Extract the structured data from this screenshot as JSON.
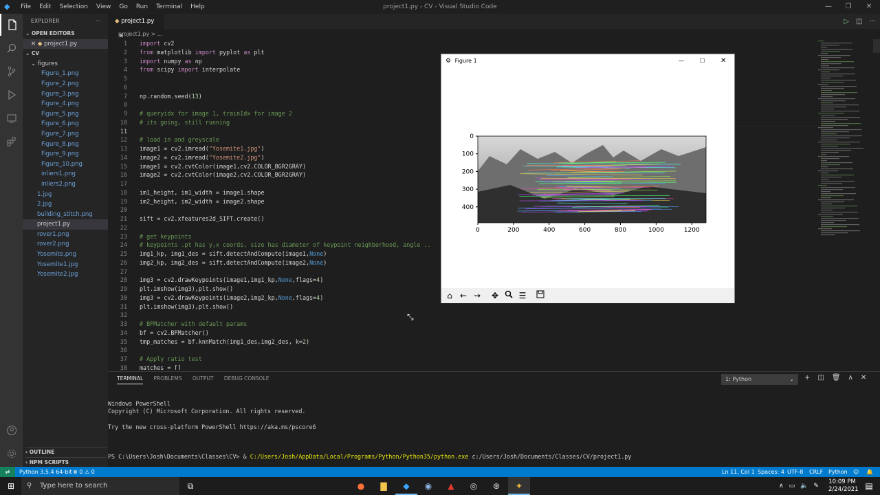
{
  "window": {
    "title": "project1.py - CV - Visual Studio Code",
    "menu": [
      "File",
      "Edit",
      "Selection",
      "View",
      "Go",
      "Run",
      "Terminal",
      "Help"
    ]
  },
  "sidebar": {
    "header": "EXPLORER",
    "open_editors_label": "OPEN EDITORS",
    "open_file": "project1.py",
    "root": "CV",
    "folder": "figures",
    "figure_files": [
      "Figure_1.png",
      "Figure_2.png",
      "Figure_3.png",
      "Figure_4.png",
      "Figure_5.png",
      "Figure_6.png",
      "Figure_7.png",
      "Figure_8.png",
      "Figure_9.png",
      "Figure_10.png",
      "inliers1.png",
      "inliers2.png"
    ],
    "root_files": [
      "1.jpg",
      "2.jpg",
      "building_stitch.png",
      "project1.py",
      "rover1.png",
      "rover2.png",
      "Yosemite.png",
      "Yosemite1.jpg",
      "Yosemite2.jpg"
    ],
    "outline_label": "OUTLINE",
    "npm_label": "NPM SCRIPTS"
  },
  "tabs": {
    "active": "project1.py"
  },
  "breadcrumb": "project1.py > ...",
  "code_lines": [
    "import cv2",
    "from matplotlib import pyplot as plt",
    "import numpy as np",
    "from scipy import interpolate",
    "",
    "",
    "np.random.seed(13)",
    "",
    "# queryidx for image 1, trainIdx for image 2",
    "# its going, still running",
    "",
    "# load in and greyscale",
    "image1 = cv2.imread(\"Yosemite1.jpg\")",
    "image2 = cv2.imread(\"Yosemite2.jpg\")",
    "image1 = cv2.cvtColor(image1,cv2.COLOR_BGR2GRAY)",
    "image2 = cv2.cvtColor(image2,cv2.COLOR_BGR2GRAY)",
    "",
    "im1_height, im1_width = image1.shape",
    "im2_height, im2_width = image2.shape",
    "",
    "sift = cv2.xfeatures2d_SIFT.create()",
    "",
    "# get keypoints",
    "# keypoints .pt has y,x coords, size has diameter of keypoint neighborhood, angle ..",
    "img1_kp, img1_des = sift.detectAndCompute(image1,None)",
    "img2_kp, img2_des = sift.detectAndCompute(image2,None)",
    "",
    "img3 = cv2.drawKeypoints(image1,img1_kp,None,flags=4)",
    "plt.imshow(img3),plt.show()",
    "img3 = cv2.drawKeypoints(image2,img2_kp,None,flags=4)",
    "plt.imshow(img3),plt.show()",
    "",
    "# BFMatcher with default params",
    "bf = cv2.BFMatcher()",
    "tmp_matches = bf.knnMatch(img1_des,img2_des, k=2)",
    "",
    "# Apply ratio test",
    "matches = []"
  ],
  "figure": {
    "title": "Figure 1",
    "x_ticks": [
      "0",
      "200",
      "400",
      "600",
      "800",
      "1000",
      "1200"
    ],
    "y_ticks": [
      "0",
      "100",
      "200",
      "300",
      "400"
    ]
  },
  "panel": {
    "tabs": [
      "TERMINAL",
      "PROBLEMS",
      "OUTPUT",
      "DEBUG CONSOLE"
    ],
    "terminal_selector": "1: Python",
    "lines": [
      "Windows PowerShell",
      "Copyright (C) Microsoft Corporation. All rights reserved.",
      "",
      "Try the new cross-platform PowerShell https://aka.ms/pscore6",
      ""
    ],
    "prompt": "PS C:\\Users\\Josh\\Documents\\Classes\\CV> & ",
    "exe": "C:/Users/Josh/AppData/Local/Programs/Python/Python35/python.exe",
    "script": " c:/Users/Josh/Documents/Classes/CV/project1.py"
  },
  "statusbar": {
    "python": "Python 3.5.4 64-bit",
    "problems": "⊗ 0 ⚠ 0",
    "position": "Ln 11, Col 1",
    "spaces": "Spaces: 4",
    "encoding": "UTF-8",
    "eol": "CRLF",
    "language": "Python"
  },
  "taskbar": {
    "search_placeholder": "Type here to search",
    "time": "10:09 PM",
    "date": "2/24/2021"
  },
  "colors": {
    "accent": "#007acc",
    "keyword": "#c586c0",
    "comment": "#6a9955",
    "string": "#ce9178"
  }
}
